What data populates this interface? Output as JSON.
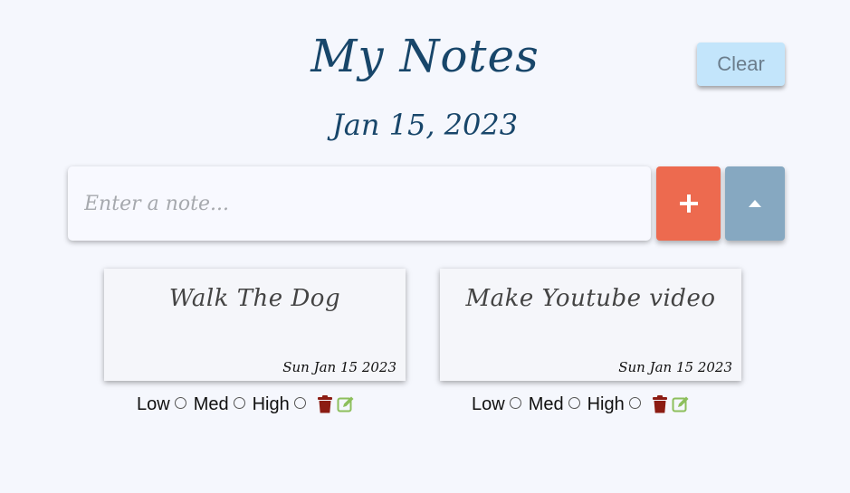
{
  "header": {
    "title": "My Notes",
    "date": "Jan 15, 2023",
    "clear_label": "Clear"
  },
  "input": {
    "placeholder": "Enter a note...",
    "value": ""
  },
  "buttons": {
    "add_icon": "plus-icon",
    "collapse_icon": "caret-up-icon"
  },
  "priorities": [
    "Low",
    "Med",
    "High"
  ],
  "notes": [
    {
      "text": "Walk The Dog",
      "date": "Sun Jan 15 2023"
    },
    {
      "text": "Make Youtube video",
      "date": "Sun Jan 15 2023"
    }
  ],
  "colors": {
    "title": "#18466a",
    "clear": "#c3e5fb",
    "add": "#ed6a4f",
    "collapse": "#86a8c1",
    "delete": "#8c1c13",
    "edit": "#8dbf5c"
  }
}
